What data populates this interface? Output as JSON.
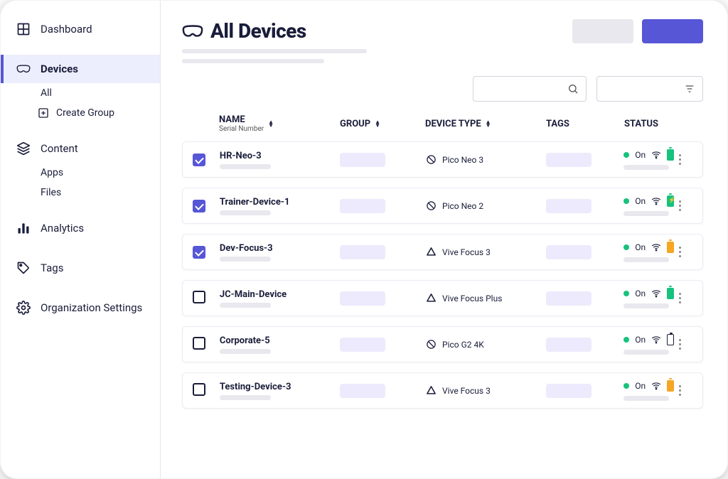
{
  "sidebar": {
    "dashboard": "Dashboard",
    "devices": "Devices",
    "devices_all": "All",
    "devices_create_group": "Create Group",
    "content": "Content",
    "content_apps": "Apps",
    "content_files": "Files",
    "analytics": "Analytics",
    "tags": "Tags",
    "org_settings": "Organization Settings"
  },
  "page": {
    "title": "All Devices"
  },
  "table": {
    "headers": {
      "name": "NAME",
      "name_sub": "Serial Number",
      "group": "GROUP",
      "device_type": "DEVICE TYPE",
      "tags": "TAGS",
      "status": "STATUS"
    },
    "rows": [
      {
        "checked": true,
        "name": "HR-Neo-3",
        "brand": "pico",
        "type": "Pico Neo 3",
        "status": "On",
        "battery": "full"
      },
      {
        "checked": true,
        "name": "Trainer-Device-1",
        "brand": "pico",
        "type": "Pico Neo 2",
        "status": "On",
        "battery": "charging"
      },
      {
        "checked": true,
        "name": "Dev-Focus-3",
        "brand": "htc",
        "type": "Vive Focus 3",
        "status": "On",
        "battery": "med"
      },
      {
        "checked": false,
        "name": "JC-Main-Device",
        "brand": "htc",
        "type": "Vive Focus Plus",
        "status": "On",
        "battery": "full"
      },
      {
        "checked": false,
        "name": "Corporate-5",
        "brand": "pico",
        "type": "Pico G2 4K",
        "status": "On",
        "battery": "none"
      },
      {
        "checked": false,
        "name": "Testing-Device-3",
        "brand": "htc",
        "type": "Vive Focus 3",
        "status": "On",
        "battery": "med"
      }
    ]
  },
  "colors": {
    "primary": "#5656d7",
    "success": "#17c27c",
    "warn": "#f5a623"
  }
}
